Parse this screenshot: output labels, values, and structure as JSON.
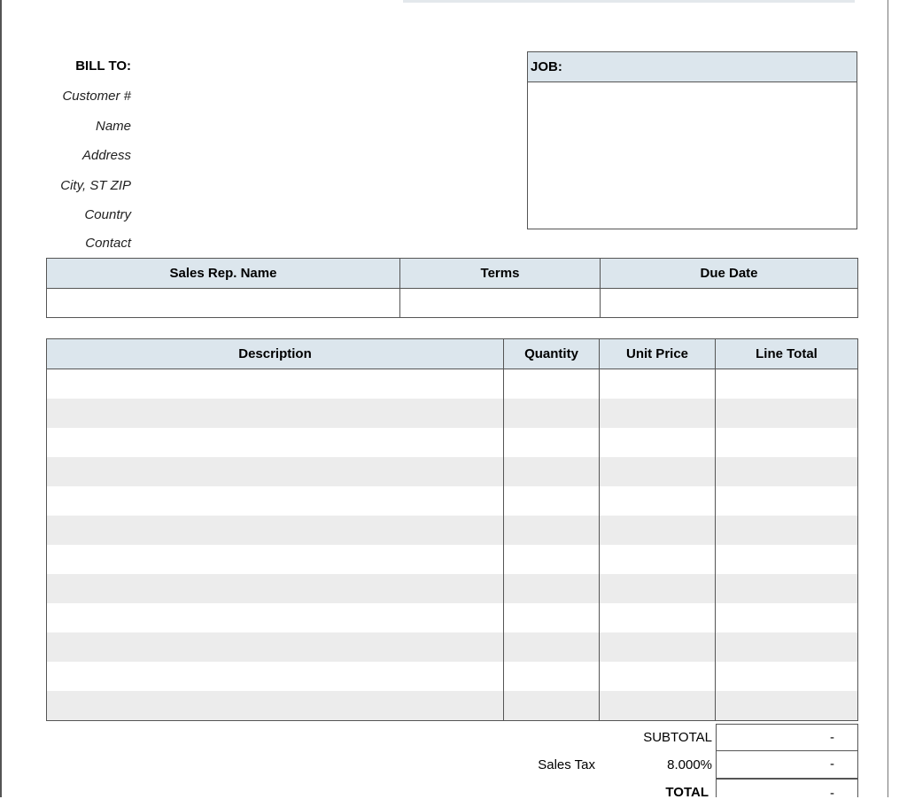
{
  "bill_to": {
    "heading": "BILL TO:",
    "fields": [
      "Customer #",
      "Name",
      "Address",
      "City, ST ZIP",
      "Country",
      "Contact"
    ]
  },
  "job": {
    "heading": "JOB:"
  },
  "sales_info": {
    "headers": [
      "Sales Rep. Name",
      "Terms",
      "Due Date"
    ]
  },
  "items": {
    "headers": [
      "Description",
      "Quantity",
      "Unit Price",
      "Line Total"
    ]
  },
  "totals": {
    "subtotal_label": "SUBTOTAL",
    "subtotal_value": "-",
    "tax_label": "Sales Tax",
    "tax_rate": "8.000%",
    "tax_value": "-",
    "total_label": "TOTAL",
    "total_value": "-"
  },
  "colors": {
    "header_fill": "#dce6ed",
    "stripe_fill": "#ececec",
    "border": "#555555"
  }
}
